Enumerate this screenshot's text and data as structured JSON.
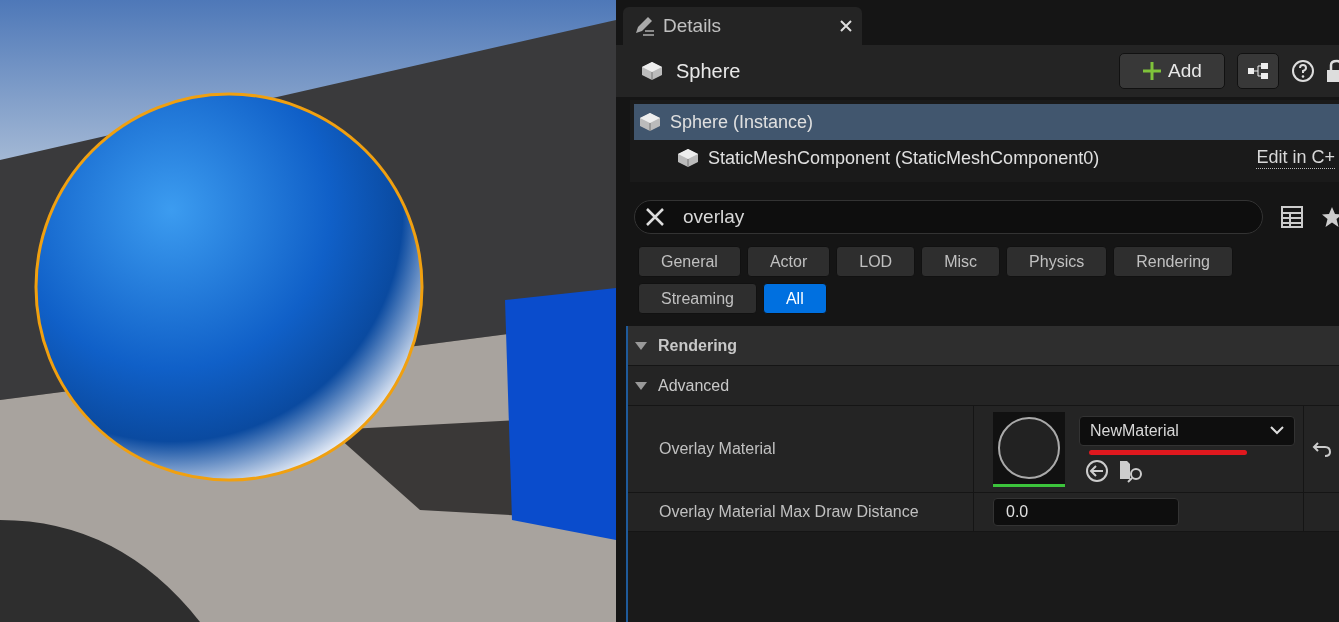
{
  "tab": {
    "title": "Details"
  },
  "header": {
    "title": "Sphere",
    "add_button": "Add"
  },
  "tree": [
    {
      "label": "Sphere (Instance)",
      "selected": true
    },
    {
      "label": "StaticMeshComponent (StaticMeshComponent0)",
      "selected": false,
      "link": "Edit in C+"
    }
  ],
  "search": {
    "value": "overlay"
  },
  "filters": [
    {
      "label": "General",
      "selected": false
    },
    {
      "label": "Actor",
      "selected": false
    },
    {
      "label": "LOD",
      "selected": false
    },
    {
      "label": "Misc",
      "selected": false
    },
    {
      "label": "Physics",
      "selected": false
    },
    {
      "label": "Rendering",
      "selected": false
    },
    {
      "label": "Streaming",
      "selected": false
    },
    {
      "label": "All",
      "selected": true
    }
  ],
  "section": {
    "title": "Rendering",
    "expanded": true
  },
  "subsection": {
    "title": "Advanced",
    "expanded": true
  },
  "properties": [
    {
      "kind": "material",
      "label": "Overlay Material",
      "value": "NewMaterial"
    },
    {
      "kind": "number",
      "label": "Overlay Material Max Draw Distance",
      "value": "0.0"
    }
  ]
}
